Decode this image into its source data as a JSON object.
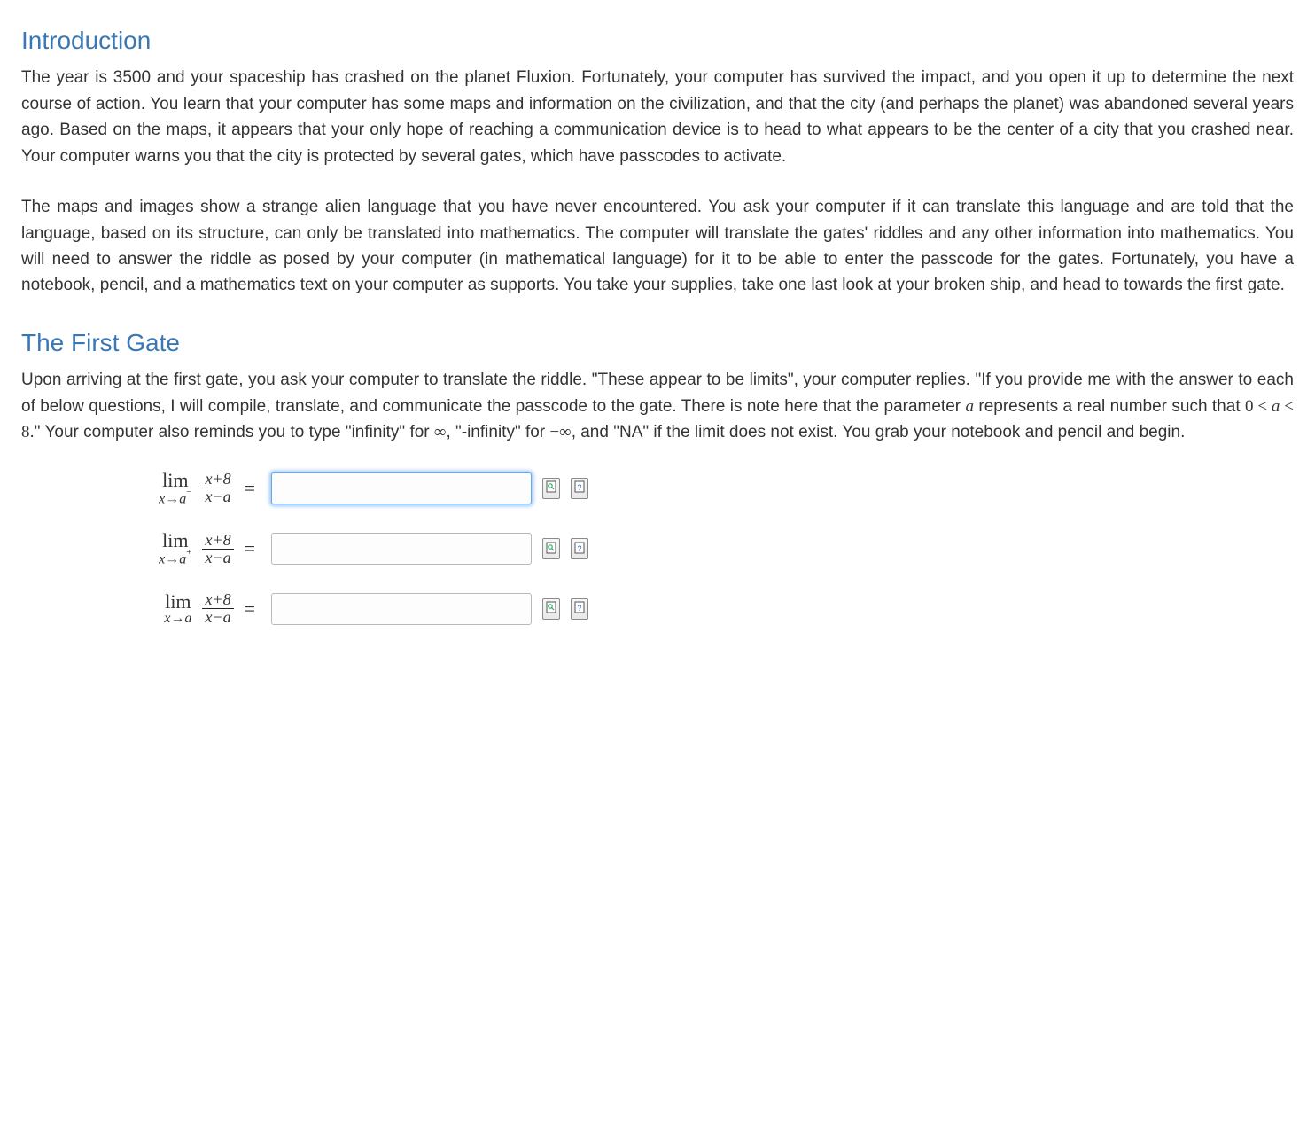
{
  "sections": {
    "intro": {
      "title": "Introduction",
      "para1": "The year is 3500 and your spaceship has crashed on the planet Fluxion. Fortunately, your computer has survived the impact, and you open it up to determine the next course of action. You learn that your computer has some maps and information on the civilization, and that the city (and perhaps the planet) was abandoned several years ago. Based on the maps, it appears that your only hope of reaching a communication device is to head to what appears to be the center of a city that you crashed near. Your computer warns you that the city is protected by several gates, which have passcodes to activate.",
      "para2": "The maps and images show a strange alien language that you have never encountered. You ask your computer if it can translate this language and are told that the language, based on its structure, can only be translated into mathematics. The computer will translate the gates' riddles and any other information into mathematics. You will need to answer the riddle as posed by your computer (in mathematical language) for it to be able to enter the passcode for the gates. Fortunately, you have a notebook, pencil, and a mathematics text on your computer as supports. You take your supplies, take one last look at your broken ship, and head to towards the first gate."
    },
    "gate1": {
      "title": "The First Gate",
      "para_pre": "Upon arriving at the first gate, you ask your computer to translate the riddle. \"These appear to be limits\", your computer replies. \"If you provide me with the answer to each of below questions, I will compile, translate, and communicate the passcode to the gate. There is note here that the parameter ",
      "param_var": "a",
      "para_mid": " represents a real number such that ",
      "inequality_html": "0 < <span class=\"math-i\">a</span> < 8",
      "para_post1": ".\" Your computer also reminds you to type \"infinity\" for ",
      "sym_inf": "∞",
      "para_post2": ", \"-infinity\" for ",
      "sym_neginf": "−∞",
      "para_post3": ", and \"NA\" if the limit does not exist. You grab your notebook and pencil and begin."
    }
  },
  "problems": [
    {
      "approach": "−",
      "numerator": "x+8",
      "denominator": "x−a",
      "value": "",
      "focused": true
    },
    {
      "approach": "+",
      "numerator": "x+8",
      "denominator": "x−a",
      "value": "",
      "focused": false
    },
    {
      "approach": "",
      "numerator": "x+8",
      "denominator": "x−a",
      "value": "",
      "focused": false
    }
  ],
  "icons": {
    "preview": "preview-icon",
    "help": "help-icon"
  }
}
